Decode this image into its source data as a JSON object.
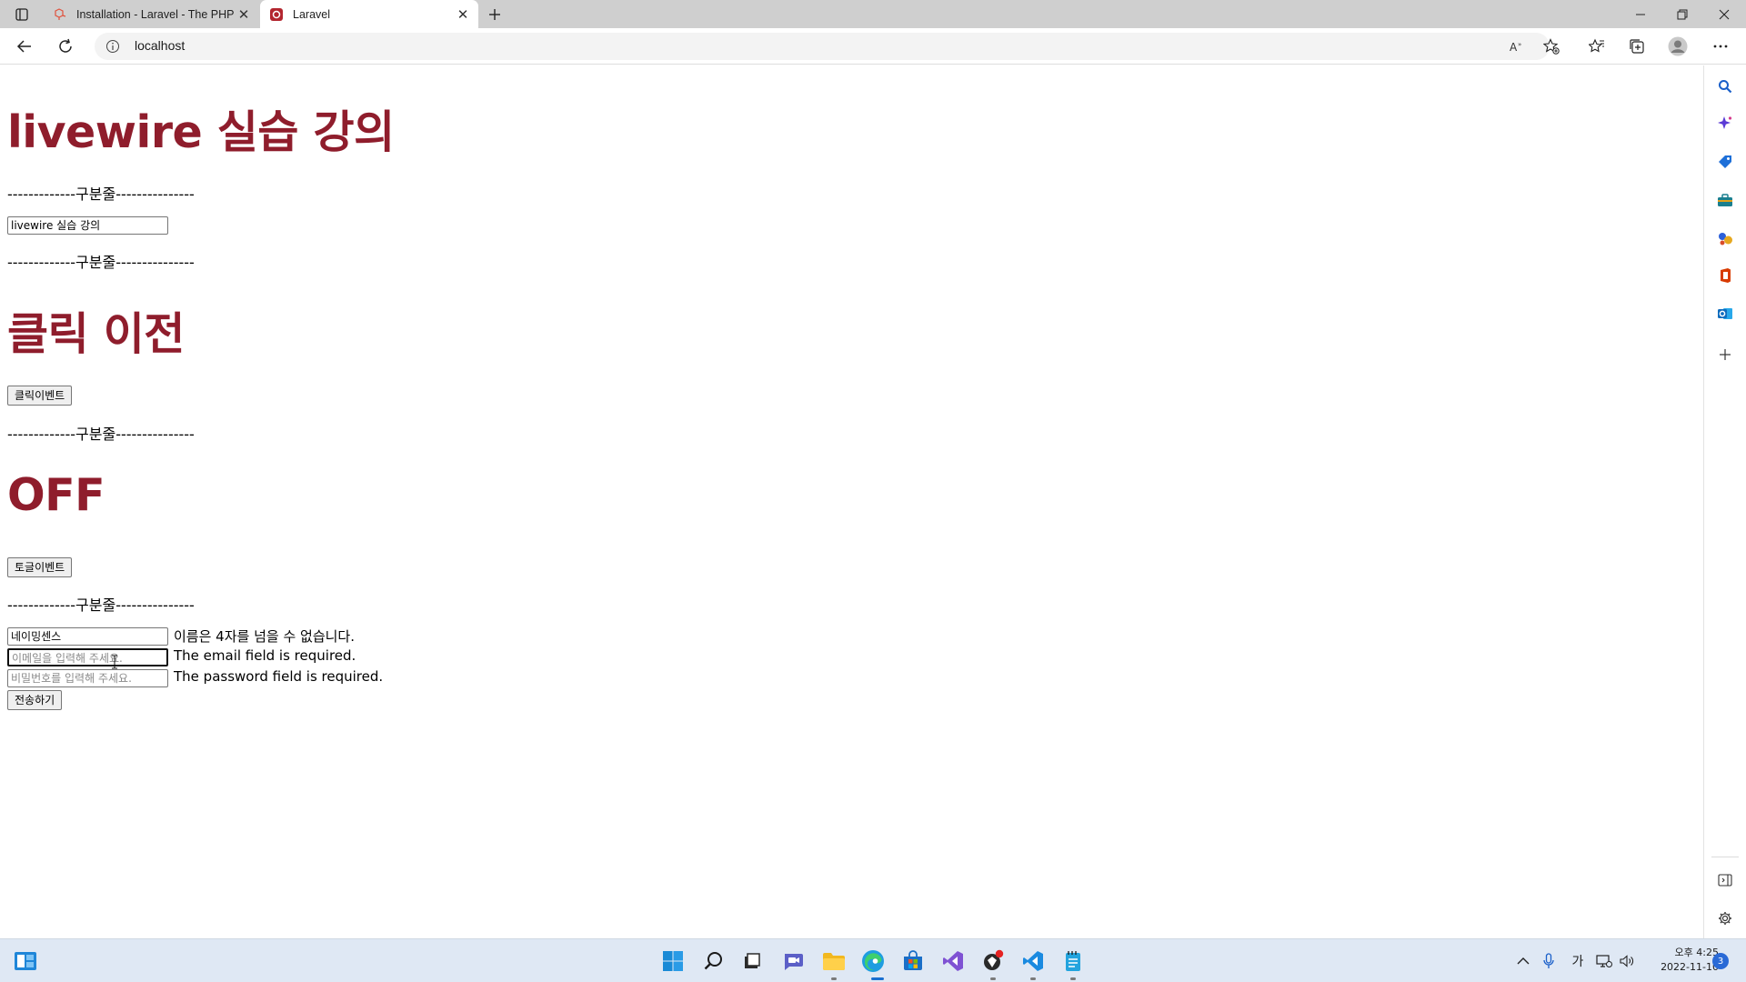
{
  "browser": {
    "tabs": [
      {
        "title": "Installation - Laravel - The PHP F",
        "active": false
      },
      {
        "title": "Laravel",
        "active": true
      }
    ],
    "address": {
      "url": "localhost"
    },
    "accent": "#1f1f1f"
  },
  "page": {
    "heading_title": "livewire 실습 강의",
    "divider_text": "-------------구분줄---------------",
    "title_input_value": "livewire 실습 강의",
    "click_heading": "클릭 이전",
    "click_button_label": "클릭이벤트",
    "toggle_heading": "OFF",
    "toggle_button_label": "토글이벤트",
    "form": {
      "name_value": "네이밍센스",
      "name_error": "이름은 4자를 넘을 수 없습니다.",
      "email_placeholder": "이메일을 입력해 주세요.",
      "email_error": "The email field is required.",
      "password_placeholder": "비밀번호를 입력해 주세요.",
      "password_error": "The password field is required.",
      "submit_label": "전송하기"
    },
    "heading_color": "#8f1d2c"
  },
  "taskbar": {
    "ime_indicator": "가",
    "clock_time": "오후 4:25",
    "clock_date": "2022-11-10",
    "notification_count": "3"
  }
}
